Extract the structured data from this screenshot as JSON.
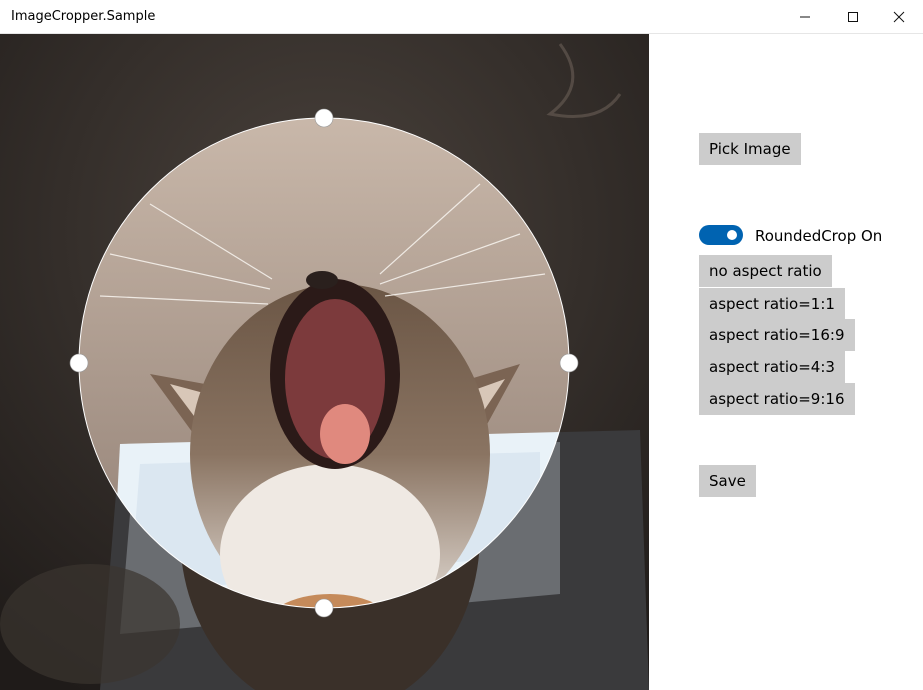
{
  "window": {
    "title": "ImageCropper.Sample"
  },
  "controls": {
    "pick_image": "Pick Image",
    "rounded_crop_label": "RoundedCrop On",
    "rounded_crop_on": true,
    "aspect_buttons": [
      "no aspect ratio",
      "aspect ratio=1:1",
      "aspect ratio=16:9",
      "aspect ratio=4:3",
      "aspect ratio=9:16"
    ],
    "save": "Save"
  },
  "colors": {
    "toggle_accent": "#0063b1",
    "button_bg": "#cccccc"
  },
  "icons": {
    "minimize": "minimize-icon",
    "maximize": "maximize-icon",
    "close": "close-icon"
  }
}
